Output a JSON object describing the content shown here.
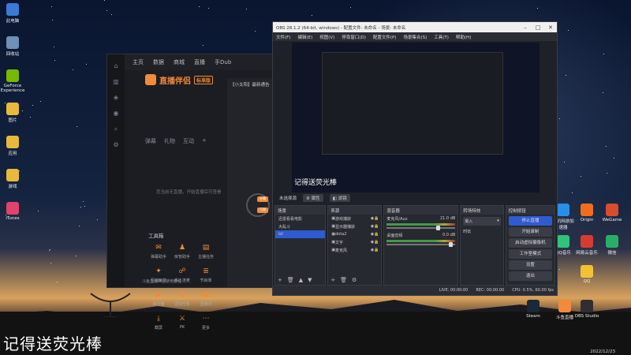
{
  "desktop_left_icons": [
    {
      "label": "此电脑",
      "icon": "computer-icon",
      "color": "#3a7bd5"
    },
    {
      "label": "回收站",
      "icon": "recycle-bin-icon",
      "color": "#6f8fb5"
    },
    {
      "label": "GeForce Experience",
      "icon": "nvidia-icon",
      "color": "#76b900"
    },
    {
      "label": "图片",
      "icon": "folder-icon",
      "color": "#e7b93c"
    },
    {
      "label": "应用",
      "icon": "folder-icon",
      "color": "#e7b93c"
    },
    {
      "label": "游戏",
      "icon": "folder-icon",
      "color": "#e7b93c"
    },
    {
      "label": "iTunes",
      "icon": "itunes-icon",
      "color": "#e0436b"
    }
  ],
  "desktop_right_icons": [
    {
      "label": "腾讯网游加速器",
      "icon": "game-accel-icon",
      "color": "#2a8ee8"
    },
    {
      "label": "Origin",
      "icon": "origin-icon",
      "color": "#f26c1c"
    },
    {
      "label": "WeGame",
      "icon": "wegame-icon",
      "color": "#d84c2f"
    },
    {
      "label": "QQ音乐",
      "icon": "qqmusic-icon",
      "color": "#31c27c"
    },
    {
      "label": "网易云音乐",
      "icon": "netease-icon",
      "color": "#d43c33"
    },
    {
      "label": "微信",
      "icon": "wechat-icon",
      "color": "#2aae67"
    },
    {
      "label": "QQ",
      "icon": "qq-icon",
      "color": "#f2c233"
    },
    {
      "label": "Steam",
      "icon": "steam-icon",
      "color": "#1b2838"
    },
    {
      "label": "斗鱼直播",
      "icon": "douyu-icon",
      "color": "#f28a3a"
    },
    {
      "label": "OBS Studio",
      "icon": "obs-icon",
      "color": "#302e31"
    }
  ],
  "app": {
    "topbar": [
      "主页",
      "数据",
      "商城",
      "直播",
      "手Dub"
    ],
    "title": "直播伴侣",
    "version": "标准版",
    "subtabs": [
      "弹幕",
      "礼物",
      "互动",
      "+"
    ],
    "no_live_text": "您当前无直播，开始直播后可查看",
    "tools_title": "工具箱",
    "tools": [
      "弹幕助手",
      "房管助手",
      "主播任务",
      "互动玩法",
      "多人连麦",
      "节目单",
      "播放器",
      "虚拟形象",
      "直播间",
      "截屏",
      "PK",
      "更多"
    ],
    "news": "【小太阳】最新通告",
    "bottom_tip": "斗鱼直播伴侣使用教程",
    "orbit_buttons": [
      "开播",
      "下播"
    ]
  },
  "obs": {
    "title": "OBS 28.1.2 (64-bit, windows) - 配置文件: 未命名 - 场景: 未命名",
    "menu": [
      "文件(F)",
      "编辑(E)",
      "视图(V)",
      "停靠窗口(D)",
      "配置文件(P)",
      "场景集合(S)",
      "工具(T)",
      "帮助(H)"
    ],
    "preview_caption": "记得送荧光棒",
    "no_source": "未选择源",
    "props_btn": "属性",
    "filters_btn": "滤镜",
    "scenes_title": "场景",
    "scenes": [
      "迅雷看看电影",
      "大乱斗",
      "lol"
    ],
    "selected_scene": 2,
    "sources_title": "来源",
    "sources": [
      "游戏捕获",
      "显示器捕获",
      "dota2",
      "文字",
      "麦克风"
    ],
    "mixer_title": "混音器",
    "mixer": [
      {
        "name": "麦克风/Aux",
        "db": "21.0 dB",
        "level": 0.72
      },
      {
        "name": "桌面音频",
        "db": "0.0 dB",
        "level": 0.9
      }
    ],
    "transitions_title": "转场特效",
    "transition_value": "渐入",
    "transition_duration": "时长",
    "controls_title": "控制按钮",
    "controls": [
      "停止直播",
      "开始录制",
      "启动虚拟摄像机",
      "工作室模式",
      "设置",
      "退出"
    ],
    "status_live": "LIVE: 00:00:00",
    "status_rec": "REC: 00:00:00",
    "status_cpu": "CPU: 0.5%, 60.00 fps"
  },
  "overlay_text": "记得送荧光棒",
  "clock": {
    "date": "2022/12/23"
  }
}
